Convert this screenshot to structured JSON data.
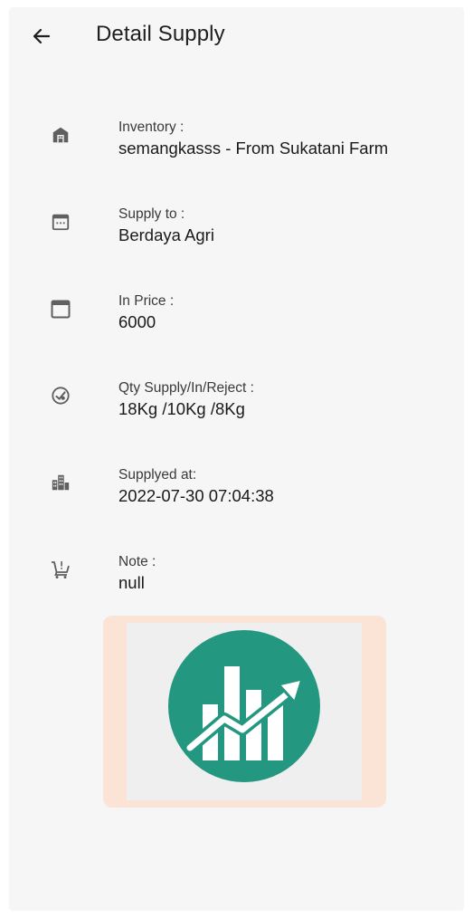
{
  "appbar": {
    "title": "Detail Supply",
    "back_icon": "arrow-left-icon"
  },
  "details": [
    {
      "label": "Inventory :",
      "value": "semangkasss - From Sukatani Farm",
      "icon": "warehouse-icon"
    },
    {
      "label": "Supply to :",
      "value": "Berdaya Agri",
      "icon": "calendar-dots-icon"
    },
    {
      "label": "In Price :",
      "value": "6000",
      "icon": "calendar-blank-icon"
    },
    {
      "label": "Qty Supply/In/Reject :",
      "value": "18Kg /10Kg /8Kg",
      "icon": "quantity-badge-icon"
    },
    {
      "label": "Supplyed at:",
      "value": "2022-07-30 07:04:38",
      "icon": "buildings-icon"
    },
    {
      "label": "Note :",
      "value": "null",
      "icon": "cart-alert-icon"
    }
  ],
  "image": {
    "icon": "growth-chart-logo",
    "colors": {
      "circle": "#23977f",
      "bars": "#ffffff",
      "card": "#fbe3d6"
    }
  },
  "colors": {
    "background": "#f6f6f6",
    "text": "#1a1a1a",
    "icon": "#5f5f5f"
  }
}
